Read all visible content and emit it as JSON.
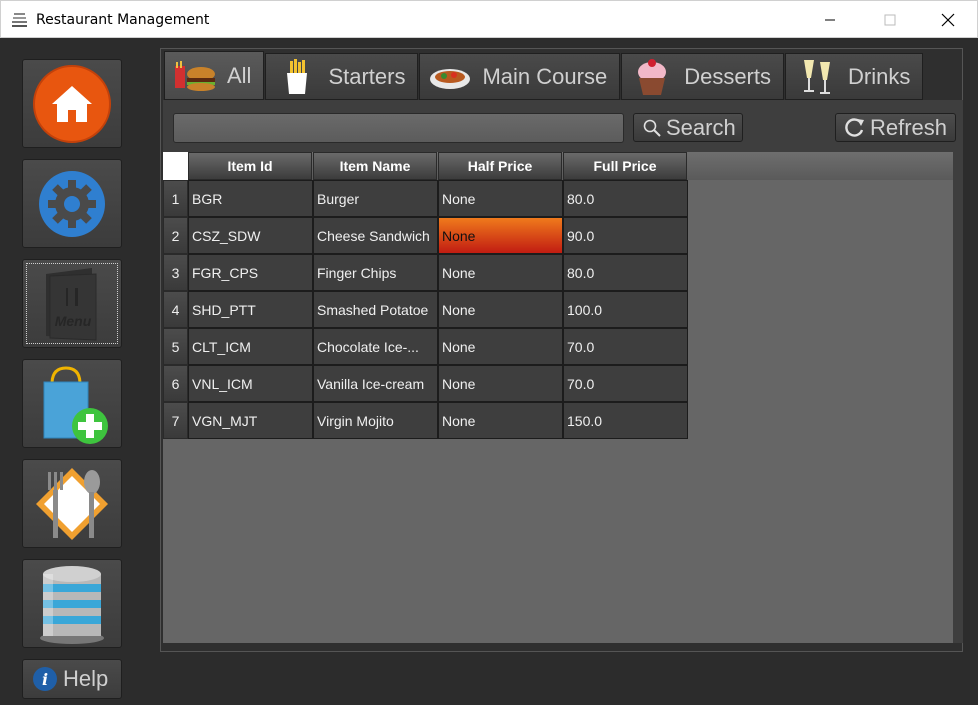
{
  "window": {
    "title": "Restaurant Management"
  },
  "sidebar": {
    "items": [
      {
        "name": "home"
      },
      {
        "name": "settings"
      },
      {
        "name": "menu",
        "icon_text": "Menu"
      },
      {
        "name": "add-order"
      },
      {
        "name": "dining"
      },
      {
        "name": "database"
      }
    ],
    "help_label": "Help"
  },
  "tabs": [
    {
      "label": "All",
      "active": true
    },
    {
      "label": "Starters"
    },
    {
      "label": "Main Course"
    },
    {
      "label": "Desserts"
    },
    {
      "label": "Drinks"
    }
  ],
  "toolbar": {
    "search_value": "",
    "search_label": "Search",
    "refresh_label": "Refresh"
  },
  "table": {
    "columns": [
      "Item Id",
      "Item Name",
      "Half Price",
      "Full Price"
    ],
    "rows": [
      {
        "num": "1",
        "id": "BGR",
        "name": "Burger",
        "half": "None",
        "full": "80.0"
      },
      {
        "num": "2",
        "id": "CSZ_SDW",
        "name": "Cheese Sandwich",
        "half": "None",
        "full": "90.0"
      },
      {
        "num": "3",
        "id": "FGR_CPS",
        "name": "Finger Chips",
        "half": "None",
        "full": "80.0"
      },
      {
        "num": "4",
        "id": "SHD_PTT",
        "name": "Smashed Potatoe",
        "half": "None",
        "full": "100.0"
      },
      {
        "num": "5",
        "id": "CLT_ICM",
        "name": "Chocolate Ice-...",
        "half": "None",
        "full": "70.0"
      },
      {
        "num": "6",
        "id": "VNL_ICM",
        "name": "Vanilla Ice-cream",
        "half": "None",
        "full": "70.0"
      },
      {
        "num": "7",
        "id": "VGN_MJT",
        "name": "Virgin Mojito",
        "half": "None",
        "full": "150.0"
      }
    ],
    "selected_cell": {
      "row": 2,
      "column": "Half Price"
    }
  },
  "colors": {
    "selection_top": "#f07a1c",
    "selection_bottom": "#c11c12",
    "home_orange": "#e8560f",
    "settings_blue": "#2f7fd0"
  }
}
